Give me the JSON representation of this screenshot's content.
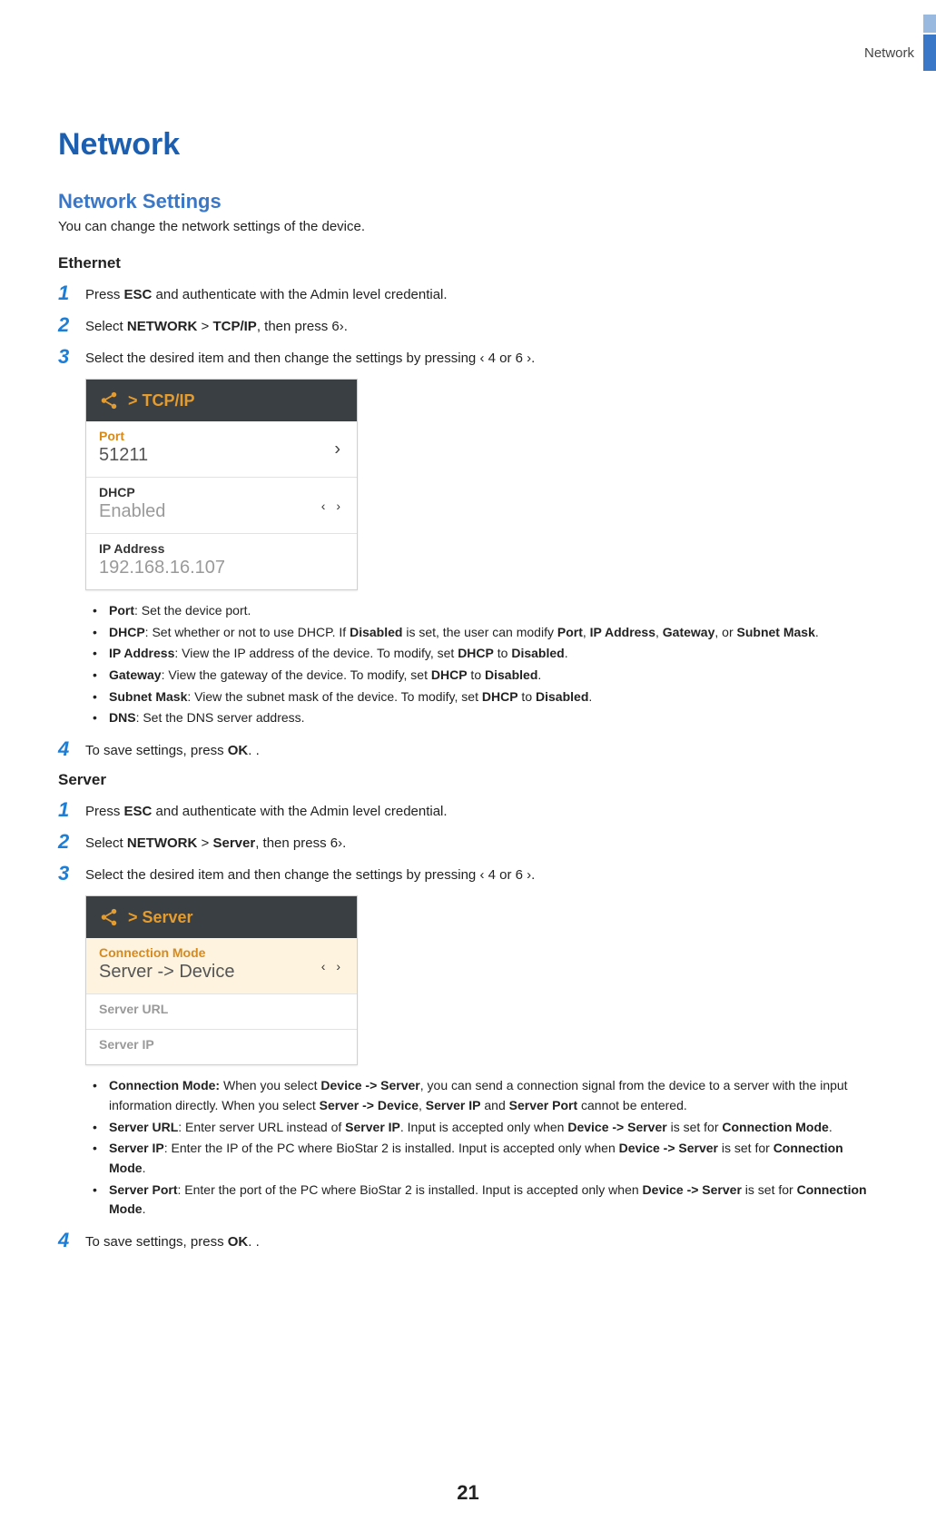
{
  "header": {
    "section_tab": "Network"
  },
  "title": "Network",
  "subtitle": "Network Settings",
  "intro": "You can change the network settings of the device.",
  "nav": {
    "left_key": "4",
    "right_key": "6",
    "left_angle": "‹",
    "right_angle": "›"
  },
  "ethernet": {
    "heading": "Ethernet",
    "steps": {
      "s1": {
        "num": "1",
        "pre": "Press ",
        "key": "ESC",
        "post": " and authenticate with the Admin level credential."
      },
      "s2": {
        "num": "2",
        "pre": "Select ",
        "p1": "NETWORK",
        "sep": " > ",
        "p2": "TCP/IP",
        "post": ", then press "
      },
      "s3": {
        "num": "3",
        "text": "Select the desired item and then change the settings by pressing "
      },
      "s4": {
        "num": "4",
        "pre": "To save settings, press ",
        "key": "OK",
        "post": ". ."
      }
    },
    "device": {
      "breadcrumb": "> TCP/IP",
      "rows": {
        "port": {
          "label": "Port",
          "value": "51211"
        },
        "dhcp": {
          "label": "DHCP",
          "value": "Enabled"
        },
        "ip": {
          "label": "IP Address",
          "value": "192.168.16.107"
        }
      }
    },
    "bullets": {
      "b1": {
        "k": "Port",
        "t": ": Set the device port."
      },
      "b2": {
        "k": "DHCP",
        "t_a": ": Set whether or not to use DHCP. If ",
        "k2": "Disabled",
        "t_b": " is set, the user can modify ",
        "k3": "Port",
        "c1": ", ",
        "k4": "IP Address",
        "c2": ", ",
        "k5": "Gateway",
        "c3": ", or ",
        "k6": "Subnet Mask",
        "t_c": "."
      },
      "b3": {
        "k": "IP Address",
        "t_a": ": View the IP address of the device. To modify, set ",
        "k2": "DHCP",
        "t_b": " to ",
        "k3": "Disabled",
        "t_c": "."
      },
      "b4": {
        "k": "Gateway",
        "t_a": ": View the gateway of the device. To modify, set ",
        "k2": "DHCP",
        "t_b": " to ",
        "k3": "Disabled",
        "t_c": "."
      },
      "b5": {
        "k": "Subnet Mask",
        "t_a": ": View the subnet mask of the device. To modify, set ",
        "k2": "DHCP",
        "t_b": " to ",
        "k3": "Disabled",
        "t_c": "."
      },
      "b6": {
        "k": "DNS",
        "t": ": Set the DNS server address."
      }
    }
  },
  "server": {
    "heading": "Server",
    "steps": {
      "s1": {
        "num": "1",
        "pre": "Press ",
        "key": "ESC",
        "post": " and authenticate with the Admin level credential."
      },
      "s2": {
        "num": "2",
        "pre": "Select ",
        "p1": "NETWORK",
        "sep": " > ",
        "p2": "Server",
        "post": ", then press "
      },
      "s3": {
        "num": "3",
        "text": "Select the desired item and then change the settings by pressing "
      },
      "s4": {
        "num": "4",
        "pre": "To save settings, press ",
        "key": "OK",
        "post": ". ."
      }
    },
    "device": {
      "breadcrumb": "> Server",
      "rows": {
        "mode": {
          "label": "Connection Mode",
          "value": "Server -> Device"
        },
        "url": {
          "label": "Server URL",
          "value": ""
        },
        "ip": {
          "label": "Server IP",
          "value": ""
        }
      }
    },
    "bullets": {
      "b1": {
        "k": "Connection Mode:",
        "t_a": " When you select ",
        "k2": "Device -> Server",
        "t_b": ", you can send a connection signal from the device to a server with the input information directly. When you select ",
        "k3": "Server -> Device",
        "t_c": ", ",
        "k4": "Server IP",
        "t_d": " and ",
        "k5": "Server Port",
        "t_e": " cannot be entered."
      },
      "b2": {
        "k": "Server URL",
        "t_a": ": Enter server URL instead of ",
        "k2": "Server IP",
        "t_b": ". Input is accepted only when ",
        "k3": "Device -> Server",
        "t_c": " is set for ",
        "k4": "Connection Mode",
        "t_d": "."
      },
      "b3": {
        "k": "Server IP",
        "t_a": ": Enter the IP of the PC where BioStar 2 is installed. Input is accepted only when ",
        "k2": "Device -> Server",
        "t_b": " is set for ",
        "k3": "Connection Mode",
        "t_c": "."
      },
      "b4": {
        "k": "Server Port",
        "t_a": ": Enter the port of the PC where BioStar 2 is installed. Input is accepted only when ",
        "k2": "Device -> Server",
        "t_b": " is set for ",
        "k3": "Connection Mode",
        "t_c": "."
      }
    }
  },
  "page_number": "21"
}
